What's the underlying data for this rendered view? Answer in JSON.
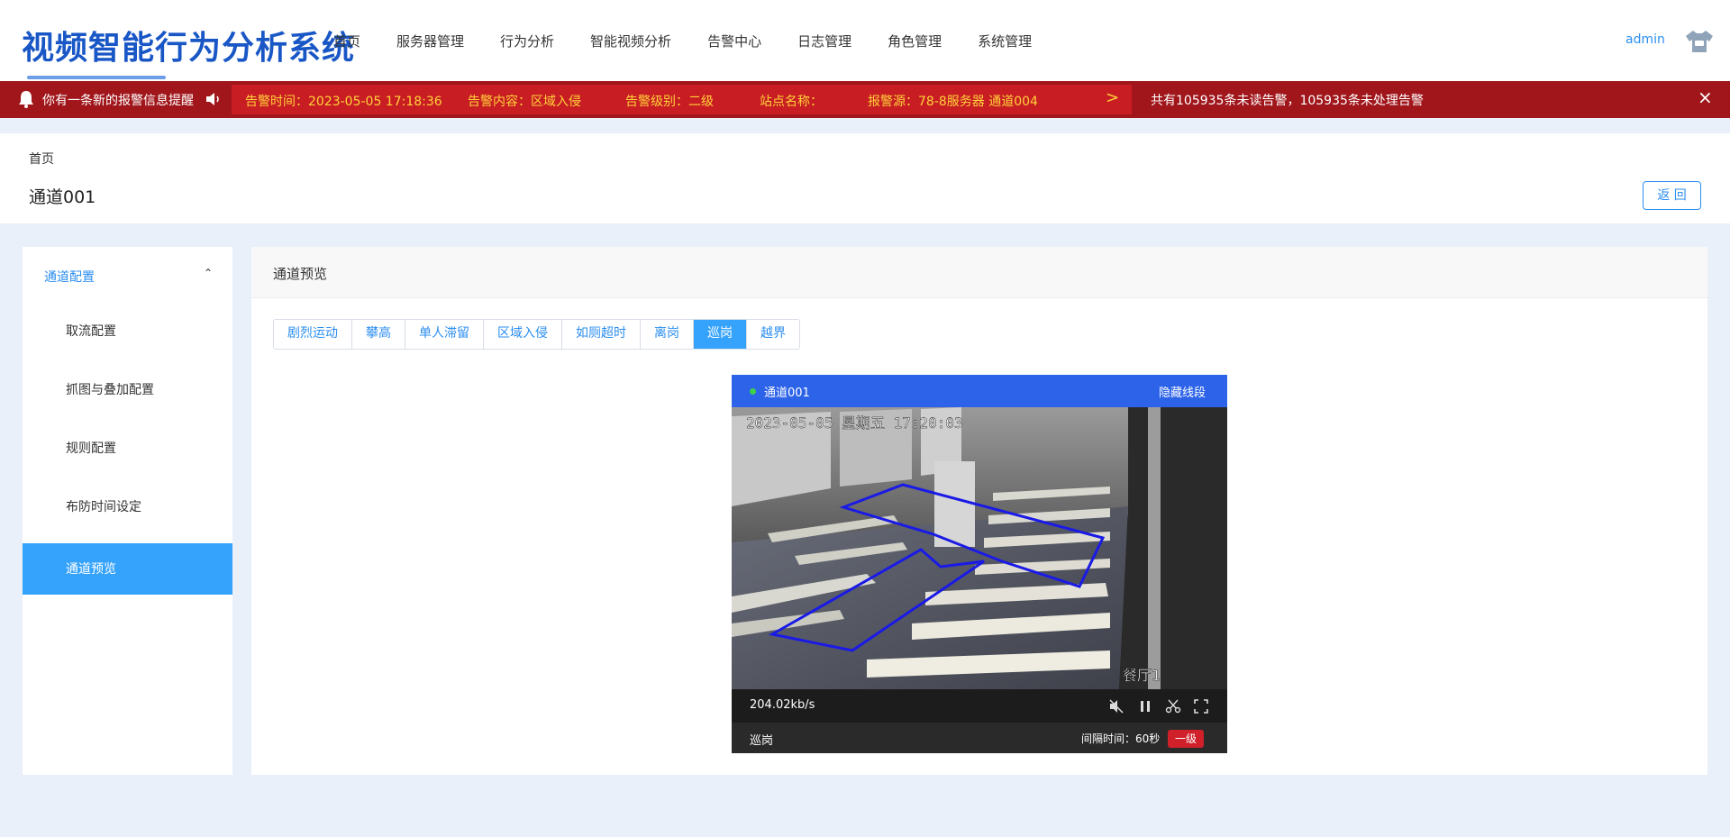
{
  "app": {
    "title": "视频智能行为分析系统",
    "nav": [
      "首页",
      "服务器管理",
      "行为分析",
      "智能视频分析",
      "告警中心",
      "日志管理",
      "角色管理",
      "系统管理"
    ],
    "user": "admin"
  },
  "alert": {
    "title": "你有一条新的报警信息提醒",
    "fields": {
      "time": "告警时间：2023-05-05 17:18:36",
      "content": "告警内容：区域入侵",
      "level": "告警级别：二级",
      "station": "站点名称：",
      "source": "报警源：78-8服务器 通道004"
    },
    "next_symbol": ">",
    "summary": "共有105935条未读告警，105935条未处理告警",
    "close_symbol": "×",
    "bar_color": "#a0161b",
    "ticker_text_color": "#ffd23a"
  },
  "page": {
    "breadcrumb": "首页",
    "title": "通道001",
    "back_label": "返 回"
  },
  "sidebar": {
    "group_label": "通道配置",
    "group_chevron": "⌃",
    "items": [
      "取流配置",
      "抓图与叠加配置",
      "规则配置",
      "布防时间设定",
      "通道预览"
    ],
    "active_index": 4
  },
  "main": {
    "title": "通道预览",
    "tabs": [
      "剧烈运动",
      "攀高",
      "单人滞留",
      "区域入侵",
      "如厕超时",
      "离岗",
      "巡岗",
      "越界"
    ],
    "active_tab_index": 6,
    "accent_color": "#35a3fb"
  },
  "video": {
    "channel": "通道001",
    "hide_lines_label": "隐藏线段",
    "osd_timestamp": "2023-05-05 星期五 17:20:03",
    "osd_location": "餐厅1",
    "bitrate": "204.02kb/s",
    "mode": "巡岗",
    "interval": "间隔时间：60秒",
    "level": "一级",
    "header_color": "#2d63e9",
    "zone_color": "#1a1ae6",
    "controls": [
      "mute-icon",
      "pause-icon",
      "scissors-icon",
      "fullscreen-icon"
    ]
  }
}
